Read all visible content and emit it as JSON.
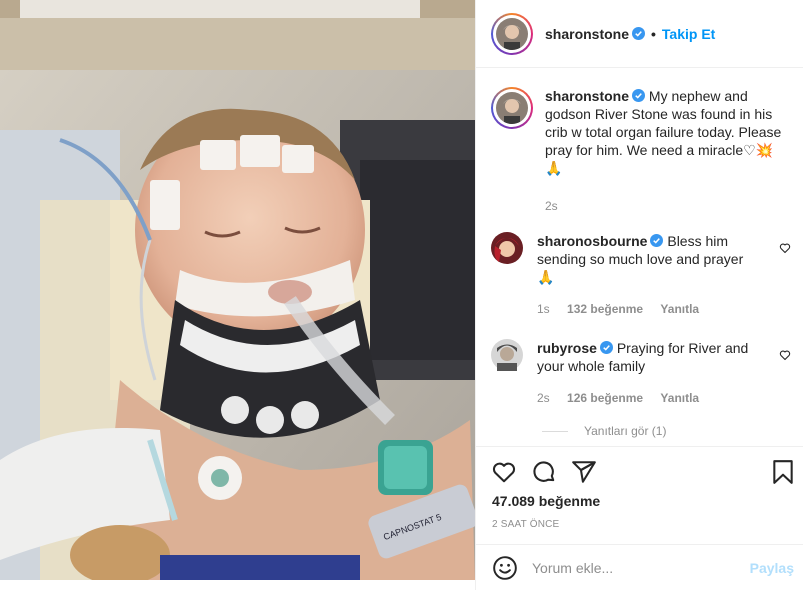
{
  "colors": {
    "accent": "#0095f6",
    "muted": "#8e8e8e",
    "verified": "#3897f0"
  },
  "header": {
    "username": "sharonstone",
    "separator": "•",
    "follow_label": "Takip Et"
  },
  "caption": {
    "username": "sharonstone",
    "text": "My nephew and godson River Stone was found in his crib w total organ failure today. Please pray for him. We need a miracle♡💥🙏",
    "time": "2s"
  },
  "comments": [
    {
      "username": "sharonosbourne",
      "text": "Bless him sending so much love and prayer 🙏",
      "time": "1s",
      "likes": "132 beğenme",
      "reply": "Yanıtla"
    },
    {
      "username": "rubyrose",
      "text": "Praying for River and your whole family",
      "time": "2s",
      "likes": "126 beğenme",
      "reply": "Yanıtla"
    }
  ],
  "view_replies": "Yanıtları gör (1)",
  "actions": {
    "likes": "47.089 beğenme",
    "time": "2 SAAT ÖNCE"
  },
  "comment_box": {
    "placeholder": "Yorum ekle...",
    "post_label": "Paylaş"
  },
  "photo": {
    "monitor_label": "CAPNOSTAT 5"
  }
}
